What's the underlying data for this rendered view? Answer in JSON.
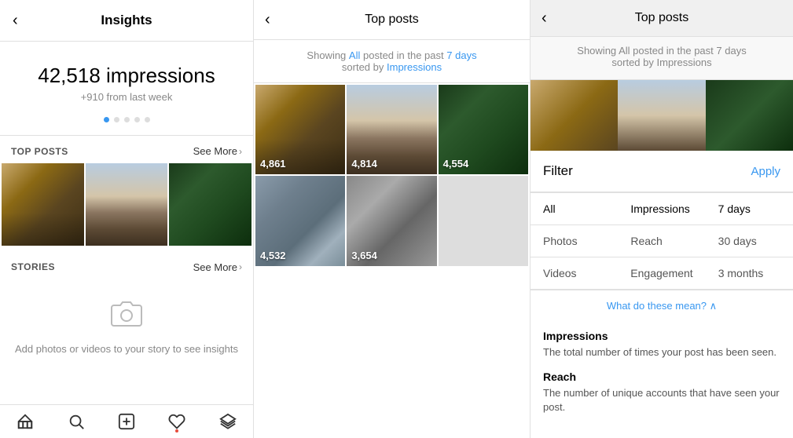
{
  "panel1": {
    "title": "Insights",
    "back_label": "‹",
    "impressions": {
      "number": "42,518 impressions",
      "change": "+910 from last week"
    },
    "top_posts_label": "TOP POSTS",
    "see_more": "See More",
    "stories_label": "STORIES",
    "stories_see_more": "See More",
    "stories_empty_text": "Add photos or videos to your story to\nsee insights",
    "nav_items": [
      "home",
      "search",
      "add",
      "heart",
      "layers"
    ]
  },
  "panel2": {
    "title": "Top posts",
    "back_label": "‹",
    "filter_line1": "Showing",
    "filter_all": "All",
    "filter_period_label": "posted in the past",
    "filter_period": "7 days",
    "filter_sorted": "sorted by",
    "filter_metric": "Impressions",
    "posts": [
      {
        "count": "4,861"
      },
      {
        "count": "4,814"
      },
      {
        "count": "4,554"
      },
      {
        "count": "4,532"
      },
      {
        "count": "3,654"
      }
    ]
  },
  "panel3": {
    "title": "Top posts",
    "back_label": "‹",
    "filter_label": "Filter",
    "apply_label": "Apply",
    "filter_line1": "Showing",
    "filter_all": "All",
    "filter_period_label": "posted in the past",
    "filter_period": "7 days",
    "filter_sorted": "sorted by",
    "filter_metric": "Impressions",
    "options_row1": [
      "All",
      "Impressions",
      "7 days"
    ],
    "options_row2": [
      "Photos",
      "Reach",
      "30 days"
    ],
    "options_row3": [
      "Videos",
      "Engagement",
      "3 months"
    ],
    "what_means": "What do these mean? ∧",
    "definitions": [
      {
        "title": "Impressions",
        "text": "The total number of times your post has been seen."
      },
      {
        "title": "Reach",
        "text": "The number of unique accounts that have seen your post."
      }
    ]
  }
}
